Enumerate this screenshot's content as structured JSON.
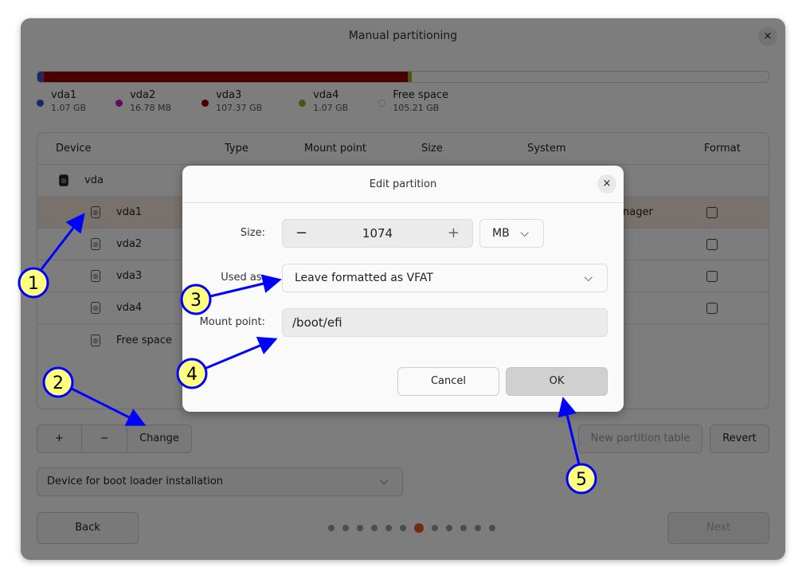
{
  "window": {
    "title": "Manual partitioning",
    "close": "×"
  },
  "usage_bar": {
    "segments": [
      {
        "name": "vda1",
        "color": "#1660c0",
        "fraction": 0.005
      },
      {
        "name": "vda2",
        "color": "#b420c0",
        "fraction": 0.0001
      },
      {
        "name": "vda3",
        "color": "#940000",
        "fraction": 0.5
      },
      {
        "name": "vda4",
        "color": "#9aad20",
        "fraction": 0.005
      },
      {
        "name": "Free space",
        "color": "#fafafa",
        "fraction": 0.49
      }
    ]
  },
  "legend": [
    {
      "name": "vda1",
      "size": "1.07 GB",
      "color": "#1660c0"
    },
    {
      "name": "vda2",
      "size": "16.78 MB",
      "color": "#b420c0"
    },
    {
      "name": "vda3",
      "size": "107.37 GB",
      "color": "#940000"
    },
    {
      "name": "vda4",
      "size": "1.07 GB",
      "color": "#9aad20"
    },
    {
      "name": "Free space",
      "size": "105.21 GB",
      "color": "#fafafa"
    }
  ],
  "table": {
    "headers": [
      "Device",
      "Type",
      "Mount point",
      "Size",
      "System",
      "Format"
    ],
    "rows": [
      {
        "device": "vda",
        "system": ""
      },
      {
        "device": "vda1",
        "system": "nager"
      },
      {
        "device": "vda2"
      },
      {
        "device": "vda3"
      },
      {
        "device": "vda4"
      },
      {
        "device": "Free space"
      }
    ]
  },
  "buttons": {
    "add": "+",
    "remove": "−",
    "change": "Change",
    "new_table": "New partition table",
    "revert": "Revert",
    "boot_loader": "Device for boot loader installation",
    "back": "Back",
    "next": "Next"
  },
  "pager": {
    "total": 12,
    "current": 7
  },
  "dialog": {
    "title": "Edit partition",
    "close": "×",
    "size_label": "Size:",
    "size_value": "1074",
    "minus": "−",
    "plus": "+",
    "unit": "MB",
    "used_as_label": "Used as:",
    "used_as": "Leave formatted as VFAT",
    "mount_label": "Mount point:",
    "mount_value": "/boot/efi",
    "cancel": "Cancel",
    "ok": "OK"
  },
  "annotations": [
    "1",
    "2",
    "3",
    "4",
    "5"
  ]
}
